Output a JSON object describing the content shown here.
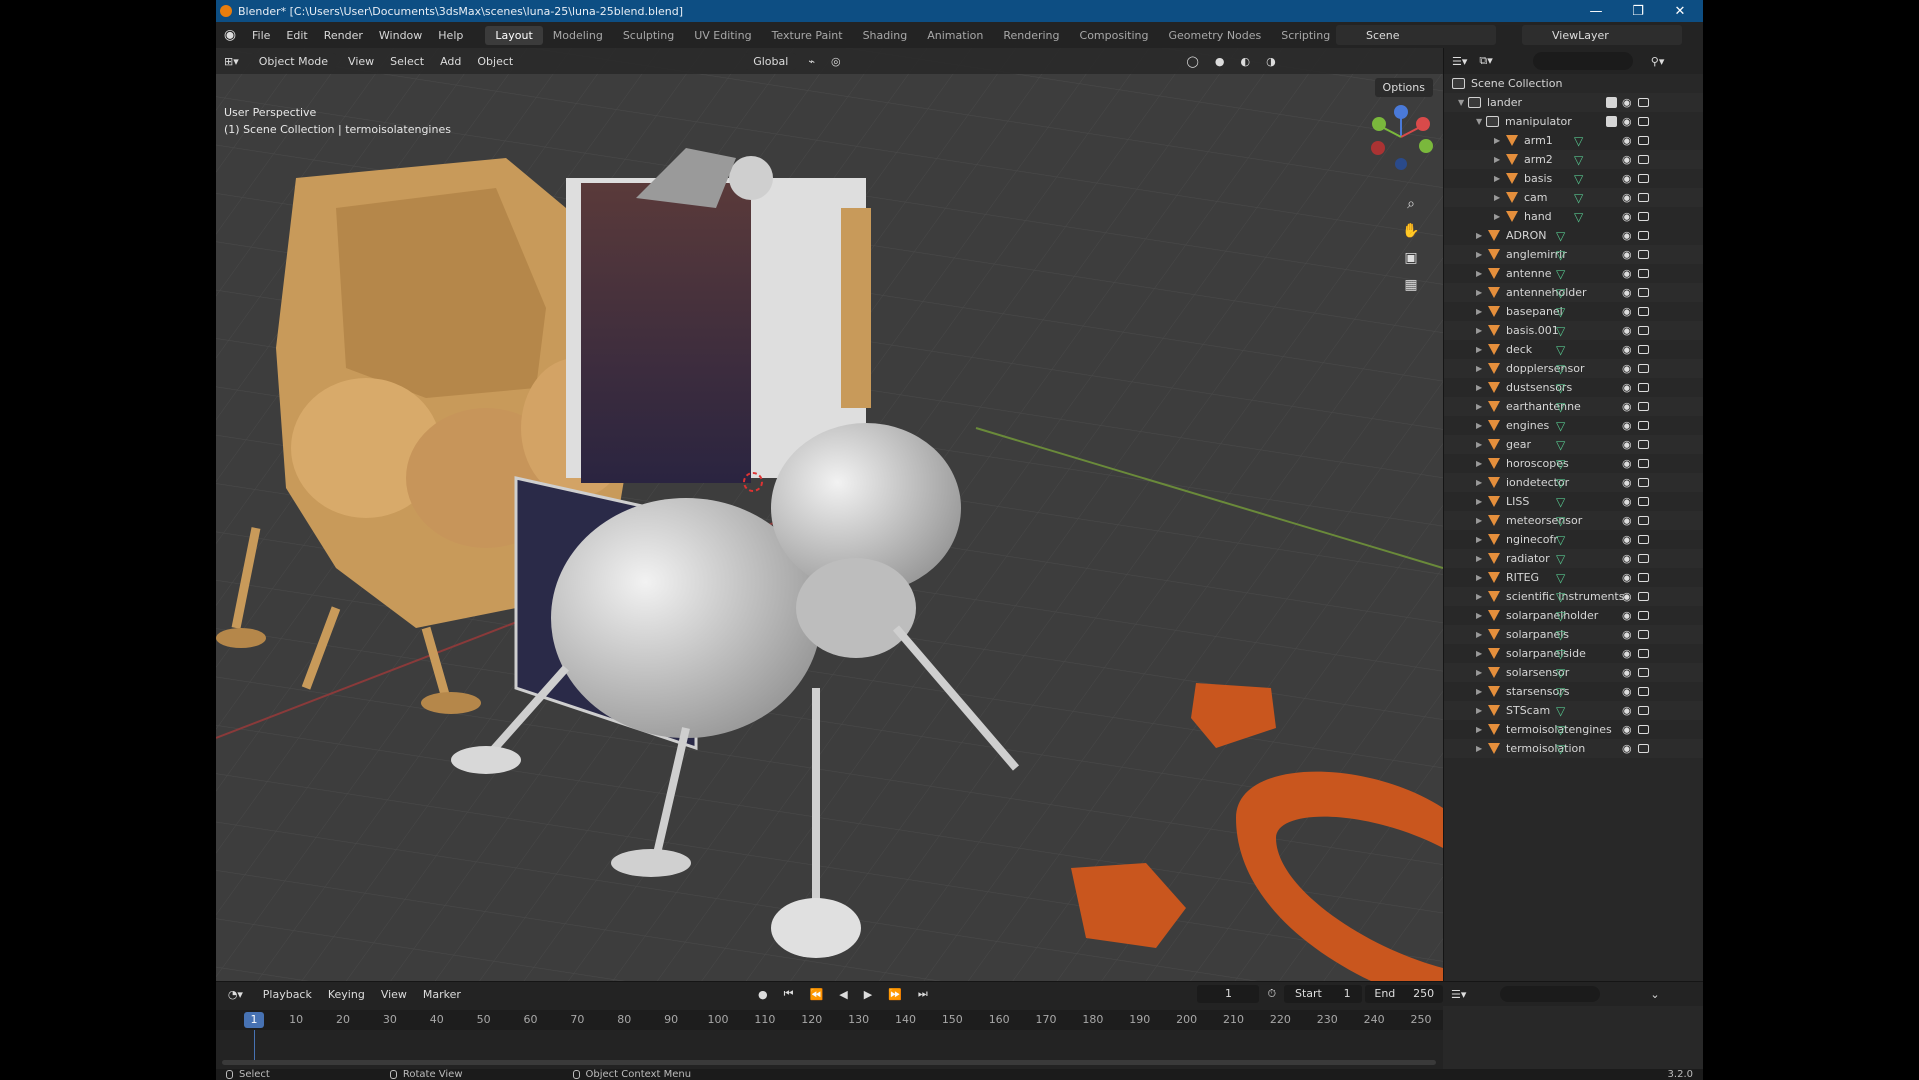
{
  "window": {
    "title": "Blender* [C:\\Users\\User\\Documents\\3dsMax\\scenes\\luna-25\\luna-25blend.blend]",
    "minimize": "—",
    "restore": "❐",
    "close": "✕"
  },
  "menu": [
    "File",
    "Edit",
    "Render",
    "Window",
    "Help"
  ],
  "workspaces": [
    "Layout",
    "Modeling",
    "Sculpting",
    "UV Editing",
    "Texture Paint",
    "Shading",
    "Animation",
    "Rendering",
    "Compositing",
    "Geometry Nodes",
    "Scripting",
    "+"
  ],
  "active_workspace": "Layout",
  "scene": "Scene",
  "view_layer": "ViewLayer",
  "viewport": {
    "mode": "Object Mode",
    "menus": [
      "View",
      "Select",
      "Add",
      "Object"
    ],
    "orientation": "Global",
    "options": "Options",
    "perspective": "User Perspective",
    "collection_info": "(1) Scene Collection | termoisolatengines"
  },
  "outliner": {
    "search_placeholder": "",
    "root": "Scene Collection",
    "lander": "lander",
    "manipulator": "manipulator",
    "manipulator_items": [
      "arm1",
      "arm2",
      "basis",
      "cam",
      "hand"
    ],
    "objects": [
      "ADRON",
      "anglemirrir",
      "antenne",
      "antenneholder",
      "basepanel",
      "basis.001",
      "deck",
      "dopplersensor",
      "dustsensors",
      "earthantenne",
      "engines",
      "gear",
      "horoscopes",
      "iondetector",
      "LISS",
      "meteorsensor",
      "nginecofr",
      "radiator",
      "RITEG",
      "scientific instruments",
      "solarpanelholder",
      "solarpanels",
      "solarpanelside",
      "solarsensor",
      "starsensors",
      "STScam",
      "termoisolatengines",
      "termoisolation"
    ]
  },
  "timeline": {
    "menus": [
      "Playback",
      "Keying",
      "View",
      "Marker"
    ],
    "current_frame": "1",
    "start_label": "Start",
    "start": "1",
    "end_label": "End",
    "end": "250",
    "ticks": [
      "1",
      "10",
      "20",
      "30",
      "40",
      "50",
      "60",
      "70",
      "80",
      "90",
      "100",
      "110",
      "120",
      "130",
      "140",
      "150",
      "160",
      "170",
      "180",
      "190",
      "200",
      "210",
      "220",
      "230",
      "240",
      "250"
    ]
  },
  "status": {
    "left": "Select",
    "middle": "Rotate View",
    "right": "Object Context Menu",
    "version": "3.2.0"
  },
  "colors": {
    "accent": "#4772b3",
    "titlebar": "#0d4e83",
    "object_orange": "#e58f3c",
    "mesh_green": "#56c48d"
  }
}
